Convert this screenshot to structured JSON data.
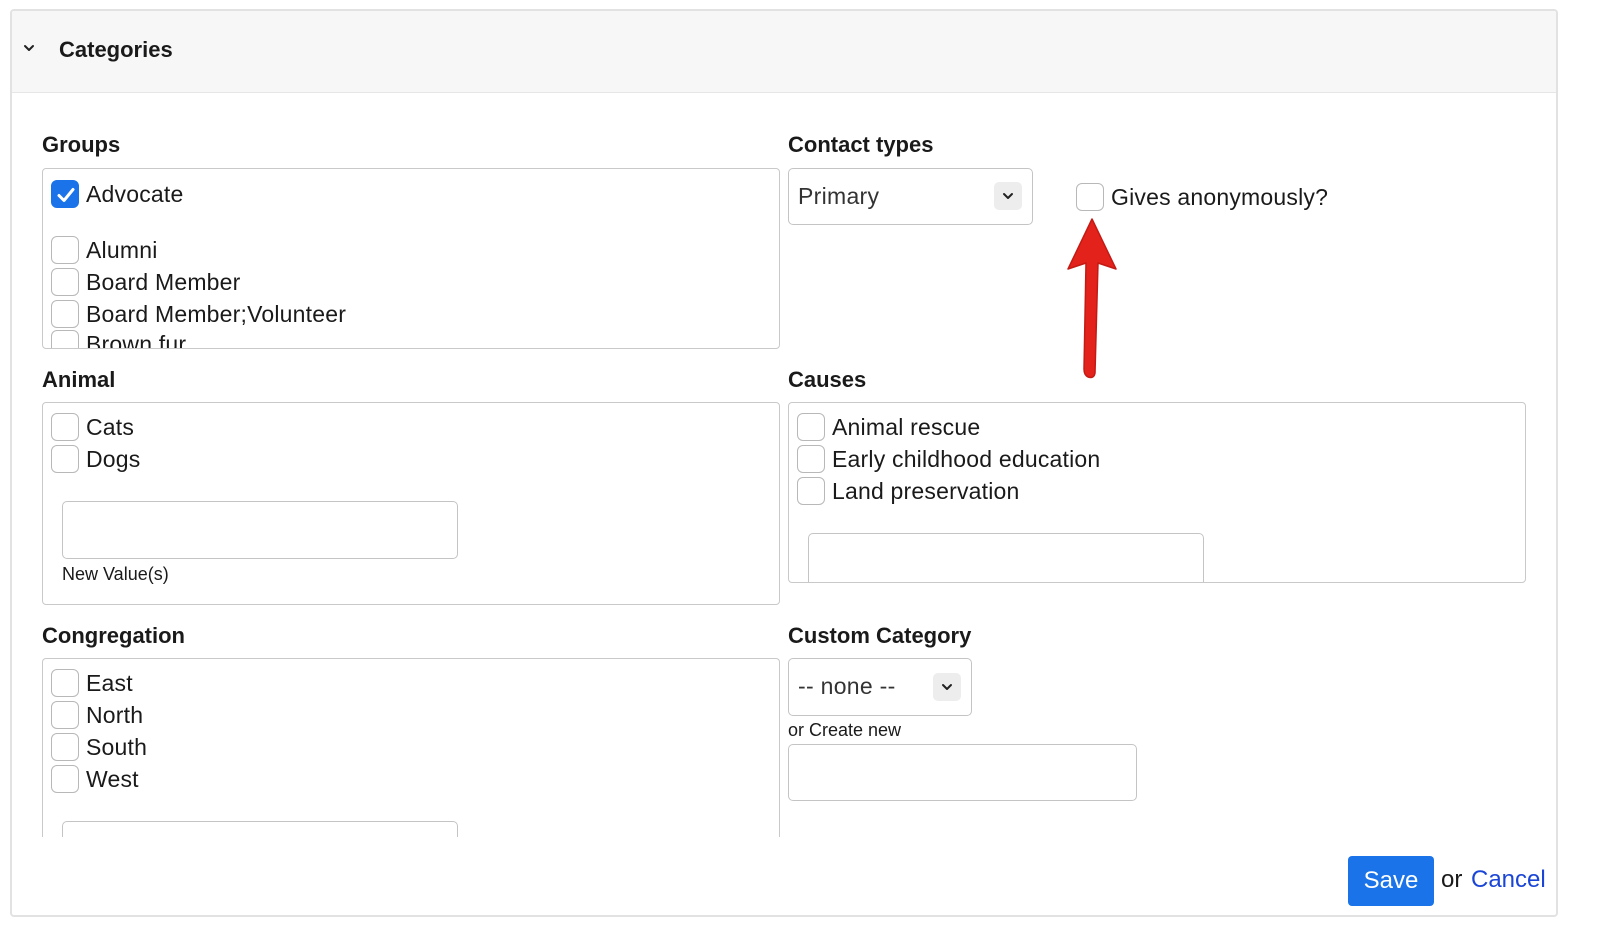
{
  "header": {
    "title": "Categories",
    "collapse_icon": "chevron-down-icon"
  },
  "groups": {
    "label": "Groups",
    "items": [
      {
        "label": "Advocate",
        "checked": true
      },
      {
        "label": "Alumni",
        "checked": false
      },
      {
        "label": "Board Member",
        "checked": false
      },
      {
        "label": "Board Member;Volunteer",
        "checked": false
      },
      {
        "label": "Brown fur",
        "checked": false
      }
    ]
  },
  "contact_types": {
    "label": "Contact types",
    "selected": "Primary",
    "gives_anonymously_label": "Gives anonymously?",
    "gives_anonymously_checked": false
  },
  "animal": {
    "label": "Animal",
    "items": [
      {
        "label": "Cats",
        "checked": false
      },
      {
        "label": "Dogs",
        "checked": false
      }
    ],
    "new_value_label": "New Value(s)",
    "new_value": ""
  },
  "causes": {
    "label": "Causes",
    "items": [
      {
        "label": "Animal rescue",
        "checked": false
      },
      {
        "label": "Early childhood education",
        "checked": false
      },
      {
        "label": "Land preservation",
        "checked": false
      }
    ],
    "new_value": ""
  },
  "congregation": {
    "label": "Congregation",
    "items": [
      {
        "label": "East",
        "checked": false
      },
      {
        "label": "North",
        "checked": false
      },
      {
        "label": "South",
        "checked": false
      },
      {
        "label": "West",
        "checked": false
      }
    ],
    "new_value": ""
  },
  "custom_category": {
    "label": "Custom Category",
    "selected": "-- none --",
    "create_new_label": "or Create new",
    "create_new_value": ""
  },
  "footer": {
    "save_label": "Save",
    "or_text": "or",
    "cancel_label": "Cancel"
  },
  "annotation": {
    "arrow_color": "#e3221b",
    "accent_color": "#1a73e8"
  }
}
